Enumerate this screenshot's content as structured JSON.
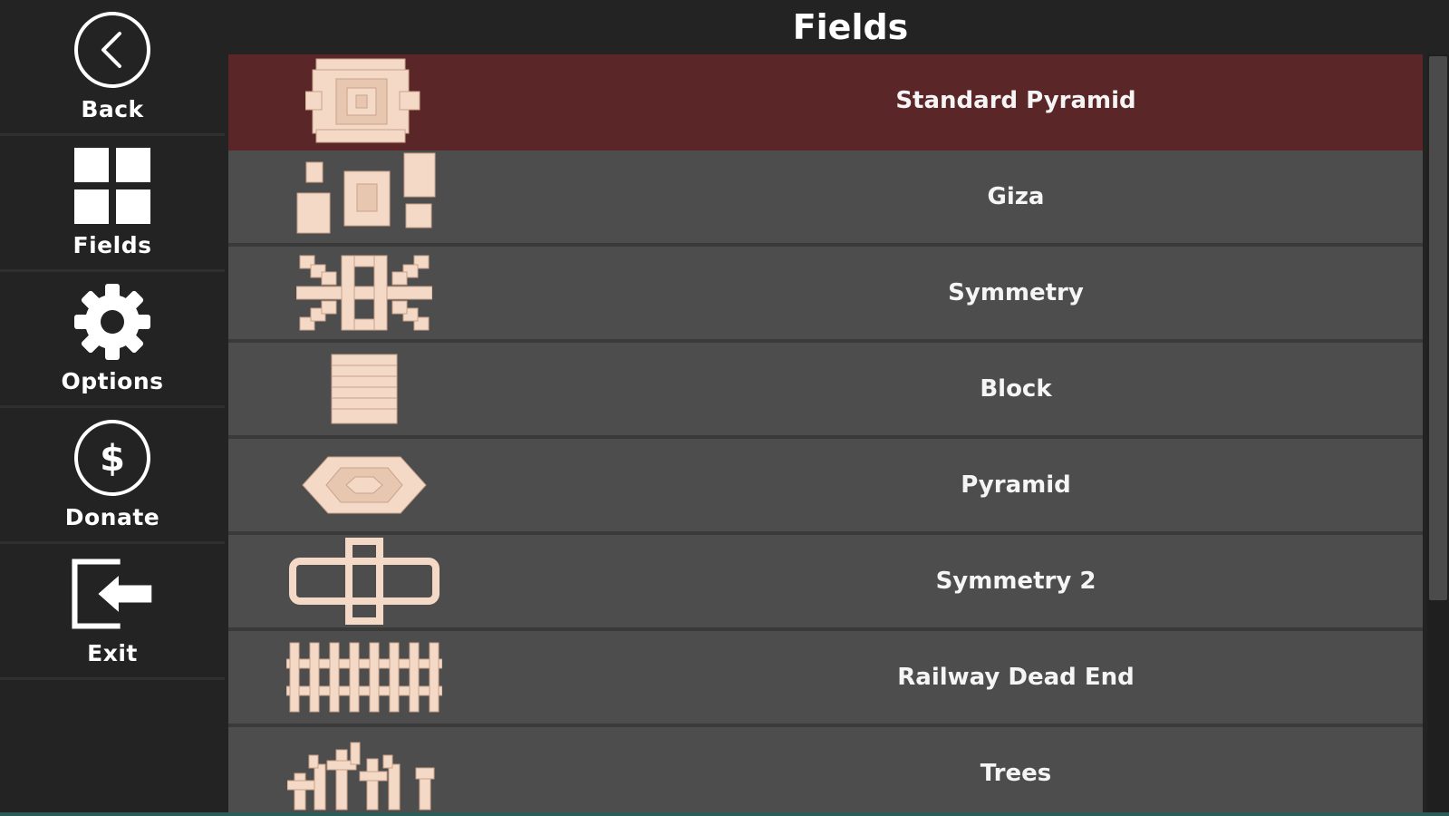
{
  "header": {
    "title": "Fields"
  },
  "sidebar": {
    "items": [
      {
        "label": "Back",
        "icon": "back-arrow-icon"
      },
      {
        "label": "Fields",
        "icon": "grid-icon"
      },
      {
        "label": "Options",
        "icon": "gear-icon"
      },
      {
        "label": "Donate",
        "icon": "dollar-icon"
      },
      {
        "label": "Exit",
        "icon": "exit-icon"
      }
    ]
  },
  "fields": [
    {
      "name": "Standard Pyramid",
      "selected": true,
      "thumbnail": "standard-pyramid-thumbnail"
    },
    {
      "name": "Giza",
      "selected": false,
      "thumbnail": "giza-thumbnail"
    },
    {
      "name": "Symmetry",
      "selected": false,
      "thumbnail": "symmetry-thumbnail"
    },
    {
      "name": "Block",
      "selected": false,
      "thumbnail": "block-thumbnail"
    },
    {
      "name": "Pyramid",
      "selected": false,
      "thumbnail": "pyramid-thumbnail"
    },
    {
      "name": "Symmetry 2",
      "selected": false,
      "thumbnail": "symmetry-2-thumbnail"
    },
    {
      "name": "Railway Dead End",
      "selected": false,
      "thumbnail": "railway-dead-end-thumbnail"
    },
    {
      "name": "Trees",
      "selected": false,
      "thumbnail": "trees-thumbnail"
    }
  ],
  "colors": {
    "background": "#232323",
    "row": "#4d4d4d",
    "selected_row": "#5b2628",
    "tile": "#f3d9c6"
  }
}
